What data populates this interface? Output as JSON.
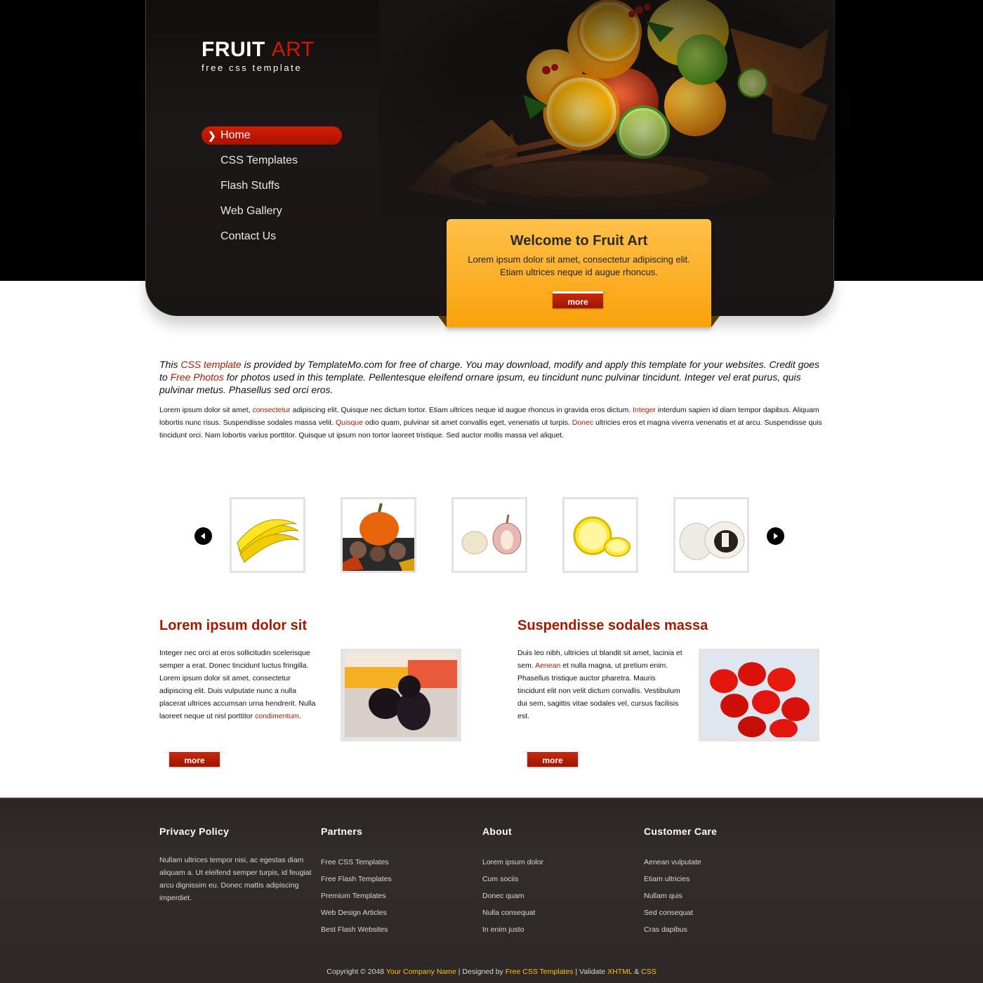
{
  "header": {
    "logo_main": "FRUIT",
    "logo_accent": "ART",
    "tagline": "free css template"
  },
  "nav": {
    "items": [
      {
        "label": "Home"
      },
      {
        "label": "CSS Templates"
      },
      {
        "label": "Flash Stuffs"
      },
      {
        "label": "Web Gallery"
      },
      {
        "label": "Contact Us"
      }
    ]
  },
  "welcome": {
    "title": "Welcome to Fruit Art",
    "text": "Lorem ipsum dolor sit amet, consectetur adipiscing elit. Etiam ultrices neque id augue rhoncus.",
    "more_label": "more"
  },
  "intro": {
    "lead": {
      "p1": "This ",
      "link1": "CSS template",
      "p2": " is provided by TemplateMo.com for free of charge. You may download, modify and apply this template for your websites. Credit goes to ",
      "link2": "Free Photos",
      "p3": " for photos used in this template. Pellentesque eleifend ornare ipsum, eu tincidunt nunc pulvinar tincidunt. Integer vel erat purus, quis pulvinar metus. Phasellus sed orci eros."
    },
    "body": {
      "t1": "Lorem ipsum dolor sit amet, ",
      "l1": "consectetur",
      "t2": " adipiscing elit. Quisque nec dictum tortor. Etiam ultrices neque id augue rhoncus in gravida eros dictum. ",
      "l2": "Integer",
      "t3": " interdum sapien id diam tempor dapibus. Aliquam lobortis nunc risus. Suspendisse sodales massa velit. ",
      "l3": "Quisque",
      "t4": " odio quam, pulvinar sit amet convallis eget, venenatis ut turpis. ",
      "l4": "Donec",
      "t5": " ultricies eros et magna viverra venenatis et at arcu. Suspendisse quis tincidunt orci. Nam lobortis varius porttitor. Quisque ut ipsum non tortor laoreet tristique. Sed auctor mollis massa vel aliquet."
    }
  },
  "gallery": {
    "items": [
      "banana-image",
      "pumpkin-image",
      "garlic-image",
      "lemon-image",
      "mushroom-image"
    ]
  },
  "columns": [
    {
      "title": "Lorem ipsum dolor sit",
      "text": "Integer nec orci at eros sollicitudin scelerisque semper a erat. Donec tincidunt luctus fringilla. Lorem ipsum dolor sit amet, consectetur adipiscing elit. Duis vulputate nunc a nulla placerat ultrices accumsan urna hendrerit. Nulla laoreet neque ut nisl porttitor ",
      "link": "condimentum",
      "text_end": ".",
      "more_label": "more"
    },
    {
      "title": "Suspendisse sodales massa",
      "text": "Duis leo nibh, ultricies ut blandit sit amet, lacinia et sem. ",
      "link": "Aenean",
      "text_end": " et nulla magna, ut pretium enim. Phasellus tristique auctor pharetra. Mauris tincidunt elit non velit dictum convallis. Vestibulum dui sem, sagittis vitae sodales vel, cursus facilisis est.",
      "more_label": "more"
    }
  ],
  "footer": {
    "privacy": {
      "title": "Privacy Policy",
      "text": "Nullam ultrices tempor nisi, ac egestas diam aliquam a. Ut eleifend semper turpis, id feugiat arcu dignissim eu. Donec mattis adipiscing imperdiet."
    },
    "partners": {
      "title": "Partners",
      "links": [
        "Free CSS Templates",
        "Free Flash Templates",
        "Premium Templates",
        "Web Design Articles",
        "Best Flash Websites"
      ]
    },
    "about": {
      "title": "About",
      "links": [
        "Lorem ipsum dolor",
        "Cum sociis",
        "Donec quam",
        "Nulla consequat",
        "In enim justo"
      ]
    },
    "care": {
      "title": "Customer Care",
      "links": [
        "Aenean vulputate",
        "Etiam ultricies",
        "Nullam quis",
        "Sed consequat",
        "Cras dapibus"
      ]
    },
    "copyright": {
      "t1": "Copyright © 2048 ",
      "company": "Your Company Name",
      "t2": " | Designed by ",
      "designer": "Free CSS Templates",
      "t3": " | Validate ",
      "xhtml": "XHTML",
      "t4": " & ",
      "css": "CSS"
    }
  },
  "colors": {
    "accent_red": "#a41a00",
    "nav_active": "#d41e00",
    "welcome_orange": "#f9a20a",
    "footer_bg": "#2e2828",
    "footer_link_yellow": "#ffc000"
  }
}
